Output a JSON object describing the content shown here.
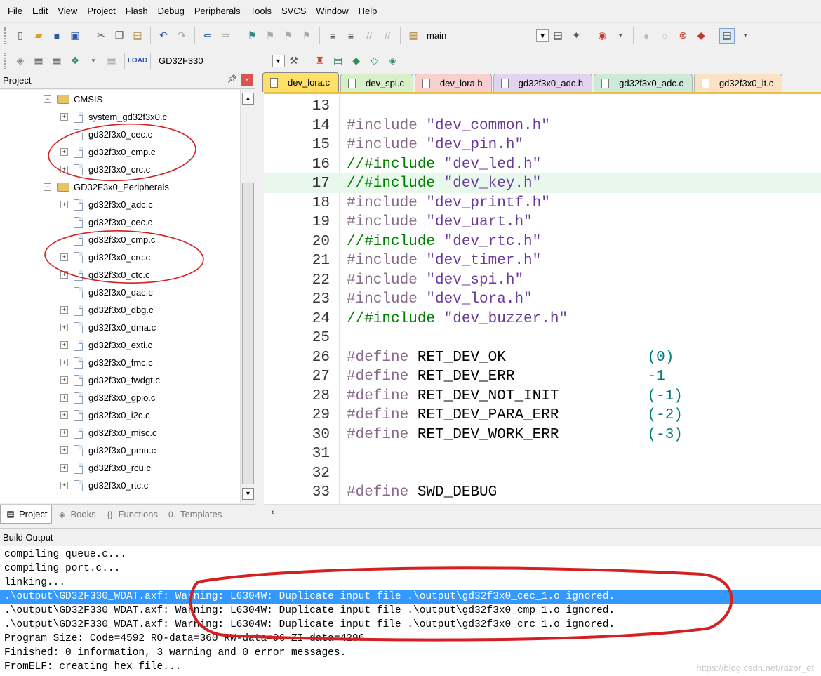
{
  "menu": [
    "File",
    "Edit",
    "View",
    "Project",
    "Flash",
    "Debug",
    "Peripherals",
    "Tools",
    "SVCS",
    "Window",
    "Help"
  ],
  "toolbar": {
    "find_text": "main",
    "target_name": "GD32F330"
  },
  "project_panel": {
    "title": "Project",
    "tree": [
      {
        "label": "CMSIS",
        "type": "folder",
        "expander": "−",
        "indent": 0
      },
      {
        "label": "system_gd32f3x0.c",
        "type": "file",
        "expander": "+",
        "indent": 1
      },
      {
        "label": "gd32f3x0_cec.c",
        "type": "file",
        "expander": "",
        "indent": 1
      },
      {
        "label": "gd32f3x0_cmp.c",
        "type": "file",
        "expander": "+",
        "indent": 1
      },
      {
        "label": "gd32f3x0_crc.c",
        "type": "file",
        "expander": "+",
        "indent": 1
      },
      {
        "label": "GD32F3x0_Peripherals",
        "type": "folder",
        "expander": "−",
        "indent": 0
      },
      {
        "label": "gd32f3x0_adc.c",
        "type": "file",
        "expander": "+",
        "indent": 1
      },
      {
        "label": "gd32f3x0_cec.c",
        "type": "file",
        "expander": "",
        "indent": 1
      },
      {
        "label": "gd32f3x0_cmp.c",
        "type": "file",
        "expander": "",
        "indent": 1
      },
      {
        "label": "gd32f3x0_crc.c",
        "type": "file",
        "expander": "+",
        "indent": 1
      },
      {
        "label": "gd32f3x0_ctc.c",
        "type": "file",
        "expander": "+",
        "indent": 1
      },
      {
        "label": "gd32f3x0_dac.c",
        "type": "file",
        "expander": "",
        "indent": 1
      },
      {
        "label": "gd32f3x0_dbg.c",
        "type": "file",
        "expander": "+",
        "indent": 1
      },
      {
        "label": "gd32f3x0_dma.c",
        "type": "file",
        "expander": "+",
        "indent": 1
      },
      {
        "label": "gd32f3x0_exti.c",
        "type": "file",
        "expander": "+",
        "indent": 1
      },
      {
        "label": "gd32f3x0_fmc.c",
        "type": "file",
        "expander": "+",
        "indent": 1
      },
      {
        "label": "gd32f3x0_fwdgt.c",
        "type": "file",
        "expander": "+",
        "indent": 1
      },
      {
        "label": "gd32f3x0_gpio.c",
        "type": "file",
        "expander": "+",
        "indent": 1
      },
      {
        "label": "gd32f3x0_i2c.c",
        "type": "file",
        "expander": "+",
        "indent": 1
      },
      {
        "label": "gd32f3x0_misc.c",
        "type": "file",
        "expander": "+",
        "indent": 1
      },
      {
        "label": "gd32f3x0_pmu.c",
        "type": "file",
        "expander": "+",
        "indent": 1
      },
      {
        "label": "gd32f3x0_rcu.c",
        "type": "file",
        "expander": "+",
        "indent": 1
      },
      {
        "label": "gd32f3x0_rtc.c",
        "type": "file",
        "expander": "+",
        "indent": 1
      }
    ],
    "tabs": [
      {
        "label": "Project",
        "icon": "project-icon",
        "active": true
      },
      {
        "label": "Books",
        "icon": "books-icon",
        "active": false
      },
      {
        "label": "Functions",
        "icon": "functions-icon",
        "active": false
      },
      {
        "label": "Templates",
        "icon": "templates-icon",
        "active": false
      }
    ]
  },
  "editor_tabs": [
    {
      "label": "dev_lora.c",
      "color": "#ffe066",
      "active": true
    },
    {
      "label": "dev_spi.c",
      "color": "#d8f0c8",
      "active": false
    },
    {
      "label": "dev_lora.h",
      "color": "#f8d0d0",
      "active": false
    },
    {
      "label": "gd32f3x0_adc.h",
      "color": "#e2d4ef",
      "active": false
    },
    {
      "label": "gd32f3x0_adc.c",
      "color": "#cfe9d8",
      "active": false
    },
    {
      "label": "gd32f3x0_it.c",
      "color": "#fbe2c4",
      "active": false
    }
  ],
  "code_lines": [
    {
      "n": "13",
      "parts": []
    },
    {
      "n": "14",
      "parts": [
        [
          "kw",
          "#include "
        ],
        [
          "str",
          "\"dev_common.h\""
        ]
      ]
    },
    {
      "n": "15",
      "parts": [
        [
          "kw",
          "#include "
        ],
        [
          "str",
          "\"dev_pin.h\""
        ]
      ]
    },
    {
      "n": "16",
      "parts": [
        [
          "cmt",
          "//#include "
        ],
        [
          "str",
          "\"dev_led.h\""
        ]
      ]
    },
    {
      "n": "17",
      "parts": [
        [
          "cmt",
          "//#include "
        ],
        [
          "str",
          "\"dev_key.h\""
        ]
      ],
      "highlight": true
    },
    {
      "n": "18",
      "parts": [
        [
          "kw",
          "#include "
        ],
        [
          "str",
          "\"dev_printf.h\""
        ]
      ]
    },
    {
      "n": "19",
      "parts": [
        [
          "kw",
          "#include "
        ],
        [
          "str",
          "\"dev_uart.h\""
        ]
      ]
    },
    {
      "n": "20",
      "parts": [
        [
          "cmt",
          "//#include "
        ],
        [
          "str",
          "\"dev_rtc.h\""
        ]
      ]
    },
    {
      "n": "21",
      "parts": [
        [
          "kw",
          "#include "
        ],
        [
          "str",
          "\"dev_timer.h\""
        ]
      ]
    },
    {
      "n": "22",
      "parts": [
        [
          "kw",
          "#include "
        ],
        [
          "str",
          "\"dev_spi.h\""
        ]
      ]
    },
    {
      "n": "23",
      "parts": [
        [
          "kw",
          "#include "
        ],
        [
          "str",
          "\"dev_lora.h\""
        ]
      ]
    },
    {
      "n": "24",
      "parts": [
        [
          "cmt",
          "//#include "
        ],
        [
          "str",
          "\"dev_buzzer.h\""
        ]
      ]
    },
    {
      "n": "25",
      "parts": []
    },
    {
      "n": "26",
      "parts": [
        [
          "kw",
          "#define "
        ],
        [
          "id",
          "RET_DEV_OK                "
        ],
        [
          "num",
          "(0)"
        ]
      ]
    },
    {
      "n": "27",
      "parts": [
        [
          "kw",
          "#define "
        ],
        [
          "id",
          "RET_DEV_ERR               "
        ],
        [
          "num",
          "-1"
        ]
      ]
    },
    {
      "n": "28",
      "parts": [
        [
          "kw",
          "#define "
        ],
        [
          "id",
          "RET_DEV_NOT_INIT          "
        ],
        [
          "num",
          "(-1)"
        ]
      ]
    },
    {
      "n": "29",
      "parts": [
        [
          "kw",
          "#define "
        ],
        [
          "id",
          "RET_DEV_PARA_ERR          "
        ],
        [
          "num",
          "(-2)"
        ]
      ]
    },
    {
      "n": "30",
      "parts": [
        [
          "kw",
          "#define "
        ],
        [
          "id",
          "RET_DEV_WORK_ERR          "
        ],
        [
          "num",
          "(-3)"
        ]
      ]
    },
    {
      "n": "31",
      "parts": []
    },
    {
      "n": "32",
      "parts": []
    },
    {
      "n": "33",
      "parts": [
        [
          "kw",
          "#define "
        ],
        [
          "id",
          "SWD_DEBUG"
        ]
      ]
    }
  ],
  "build_output": {
    "title": "Build Output",
    "lines": [
      {
        "text": "compiling queue.c...",
        "selected": false
      },
      {
        "text": "compiling port.c...",
        "selected": false
      },
      {
        "text": "linking...",
        "selected": false
      },
      {
        "text": ".\\output\\GD32F330_WDAT.axf: Warning: L6304W: Duplicate input file .\\output\\gd32f3x0_cec_1.o ignored.",
        "selected": true
      },
      {
        "text": ".\\output\\GD32F330_WDAT.axf: Warning: L6304W: Duplicate input file .\\output\\gd32f3x0_cmp_1.o ignored.",
        "selected": false
      },
      {
        "text": ".\\output\\GD32F330_WDAT.axf: Warning: L6304W: Duplicate input file .\\output\\gd32f3x0_crc_1.o ignored.",
        "selected": false
      },
      {
        "text": "Program Size: Code=4592 RO-data=360 RW-data=96 ZI-data=4296",
        "selected": false
      },
      {
        "text": "Finished: 0 information, 3 warning and 0 error messages.",
        "selected": false
      },
      {
        "text": "FromELF: creating hex file...",
        "selected": false
      }
    ]
  },
  "watermark": "https://blog.csdn.net/razor_et"
}
